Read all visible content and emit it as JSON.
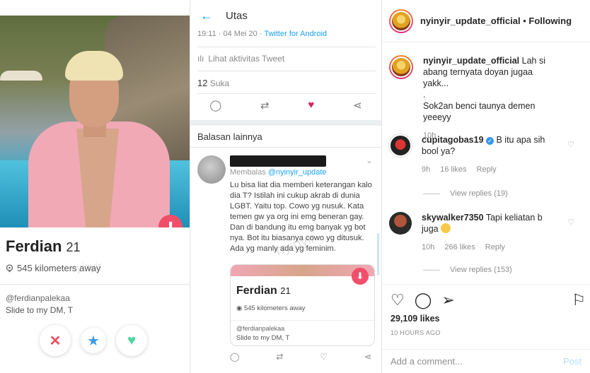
{
  "dating_card": {
    "name": "Ferdian",
    "age": "21",
    "location": "545 kilometers away",
    "handle": "@ferdianpalekaa",
    "bio": "Slide to my DM, T",
    "watermark": "nyinyir",
    "icons": {
      "location": "location-pin-icon",
      "down": "arrow-down-icon",
      "dislike": "x-icon",
      "superlike": "star-icon",
      "like": "heart-icon"
    },
    "colors": {
      "dislike": "#ef4f5e",
      "superlike": "#3d9ce5",
      "like": "#4fd4a1",
      "down": "#f04e6b"
    }
  },
  "twitter": {
    "title": "Utas",
    "timestamp": "19:11 · 04 Mei 20 ·",
    "app": "Twitter for Android",
    "activity": "Lihat aktivitas Tweet",
    "likes_count": "12",
    "likes_label": "Suka",
    "other_replies": "Balasan lainnya",
    "replying_prefix": "Membalas",
    "replying_to": "@nyinyir_update",
    "reply_text": "Lu bisa liat dia memberi keterangan kalo dia T? Istilah ini cukup akrab di dunia LGBT. Yaitu top. Cowo yg nusuk. Kata temen gw ya org ini emg beneran gay. Dan di bandung itu emg banyak yg bot nya. Bot itu biasanya cowo yg ditusuk. Ada yg manly ada yg feminim.",
    "mini_card": {
      "name": "Ferdian",
      "age": "21",
      "location": "545 kilometers away",
      "handle": "@ferdianpalekaa",
      "bio": "Slide to my DM, T"
    },
    "watermark": "nyinyir",
    "accent": "#1da1f2"
  },
  "instagram": {
    "username": "nyinyir_update_official",
    "follow_state": "Following",
    "caption": {
      "user": "nyinyir_update_official",
      "text": "Lah si abang ternyata doyan jugaa yakk...",
      "line2": ".",
      "line3": "Sok2an benci taunya demen yeeeyy",
      "time": "10h"
    },
    "comments": [
      {
        "user": "cupitagobas19",
        "text": "B itu apa sih bool ya?",
        "time": "9h",
        "likes": "16 likes",
        "reply": "Reply",
        "view_replies": "View replies (19)",
        "verified": true
      },
      {
        "user": "skywalker7350",
        "text": "Tapi keliatan b juga",
        "time": "10h",
        "likes": "266 likes",
        "reply": "Reply",
        "view_replies": "View replies (153)",
        "verified": false
      }
    ],
    "likes": "29,109 likes",
    "time_ago": "10 HOURS AGO",
    "add_comment_placeholder": "Add a comment...",
    "post_label": "Post",
    "icons": [
      "heart-outline-icon",
      "comment-icon",
      "share-icon",
      "bookmark-icon"
    ]
  }
}
